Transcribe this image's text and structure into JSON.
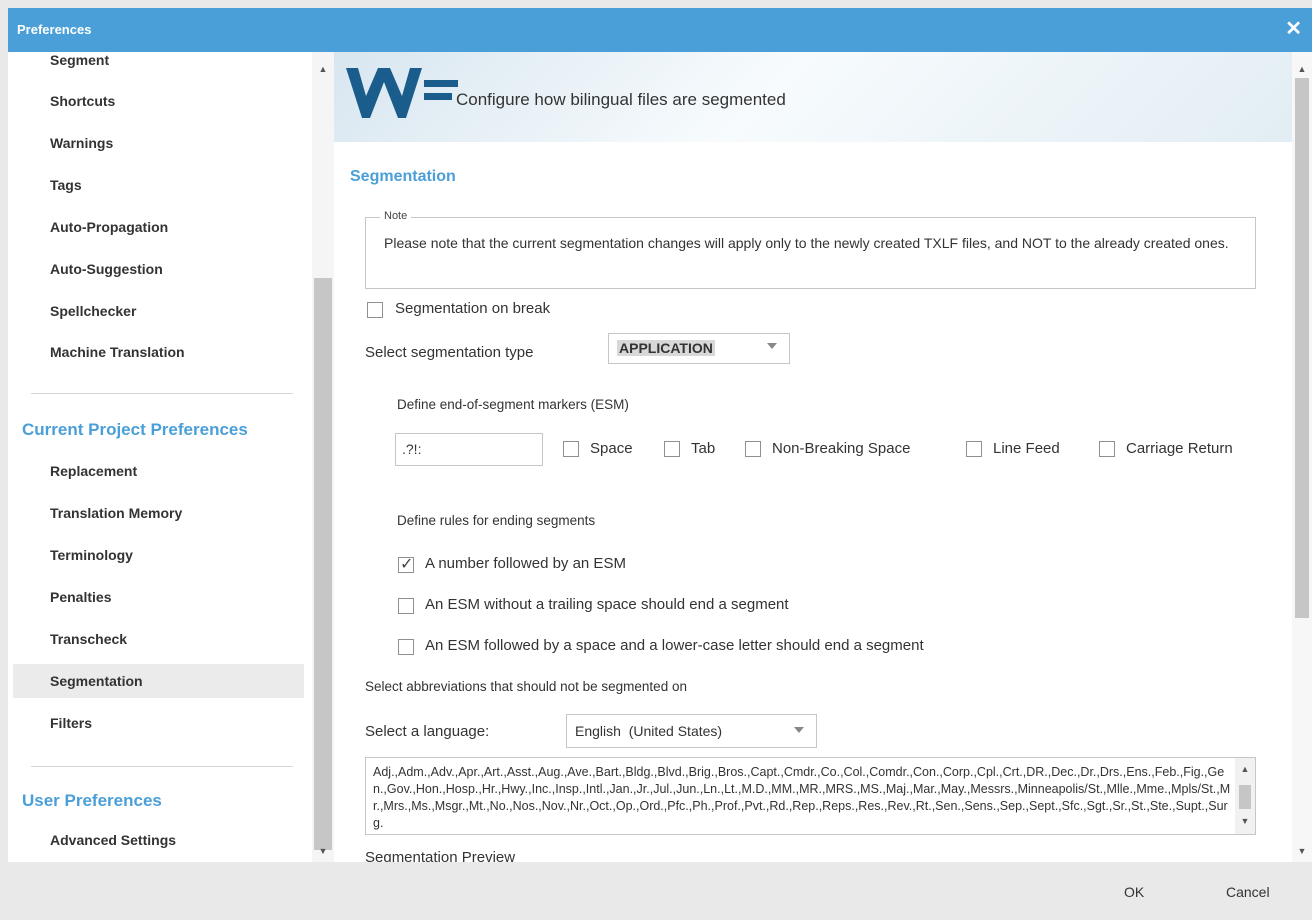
{
  "window": {
    "title": "Preferences",
    "close_icon": "close-icon"
  },
  "sidebar": {
    "items_top": [
      {
        "label": "Segment"
      },
      {
        "label": "Shortcuts"
      },
      {
        "label": "Warnings"
      },
      {
        "label": "Tags"
      },
      {
        "label": "Auto-Propagation"
      },
      {
        "label": "Auto-Suggestion"
      },
      {
        "label": "Spellchecker"
      },
      {
        "label": "Machine Translation"
      }
    ],
    "current_project_header": "Current Project Preferences",
    "items_project": [
      {
        "label": "Replacement"
      },
      {
        "label": "Translation Memory"
      },
      {
        "label": "Terminology"
      },
      {
        "label": "Penalties"
      },
      {
        "label": "Transcheck"
      },
      {
        "label": "Segmentation",
        "selected": true
      },
      {
        "label": "Filters"
      }
    ],
    "user_header": "User Preferences",
    "items_user": [
      {
        "label": "Advanced Settings"
      }
    ]
  },
  "banner": {
    "logo": "WF",
    "tagline": "Configure how bilingual files are segmented"
  },
  "main": {
    "section_title": "Segmentation",
    "note": {
      "legend": "Note",
      "text": "Please note that the current segmentation changes will apply only to the newly created TXLF files, and NOT to the already created ones."
    },
    "segmentation_on_break": {
      "label": "Segmentation on break",
      "checked": false
    },
    "seg_type": {
      "label": "Select segmentation type",
      "value": "APPLICATION"
    },
    "esm": {
      "label": "Define end-of-segment markers (ESM)",
      "value": ".?!:",
      "options": [
        {
          "label": "Space",
          "checked": false
        },
        {
          "label": "Tab",
          "checked": false
        },
        {
          "label": "Non-Breaking Space",
          "checked": false
        },
        {
          "label": "Line Feed",
          "checked": false
        },
        {
          "label": "Carriage Return",
          "checked": false
        }
      ]
    },
    "rules": {
      "label": "Define rules for ending segments",
      "items": [
        {
          "label": "A number followed by an ESM",
          "checked": true
        },
        {
          "label": "An ESM without a trailing space should end a segment",
          "checked": false
        },
        {
          "label": "An ESM followed by a space and a lower-case letter should end a segment",
          "checked": false
        }
      ]
    },
    "abbr_label": "Select abbreviations that should not be segmented on",
    "language": {
      "label": "Select a language:",
      "value": "English  (United States)"
    },
    "abbreviations": "Adj.,Adm.,Adv.,Apr.,Art.,Asst.,Aug.,Ave.,Bart.,Bldg.,Blvd.,Brig.,Bros.,Capt.,Cmdr.,Co.,Col.,Comdr.,Con.,Corp.,Cpl.,Crt.,DR.,Dec.,Dr.,Drs.,Ens.,Feb.,Fig.,Gen.,Gov.,Hon.,Hosp.,Hr.,Hwy.,Inc.,Insp.,Intl.,Jan.,Jr.,Jul.,Jun.,Ln.,Lt.,M.D.,MM.,MR.,MRS.,MS.,Maj.,Mar.,May.,Messrs.,Minneapolis/St.,Mlle.,Mme.,Mpls/St.,Mr.,Mrs.,Ms.,Msgr.,Mt.,No.,Nos.,Nov.,Nr.,Oct.,Op.,Ord.,Pfc.,Ph.,Prof.,Pvt.,Rd.,Rep.,Reps.,Res.,Rev.,Rt.,Sen.,Sens.,Sep.,Sept.,Sfc.,Sgt.,Sr.,St.,Ste.,Supt.,Surg.",
    "preview_label": "Segmentation Preview"
  },
  "footer": {
    "ok": "OK",
    "cancel": "Cancel"
  },
  "colors": {
    "accent": "#4a9fd8",
    "logo": "#1a5d8c"
  }
}
